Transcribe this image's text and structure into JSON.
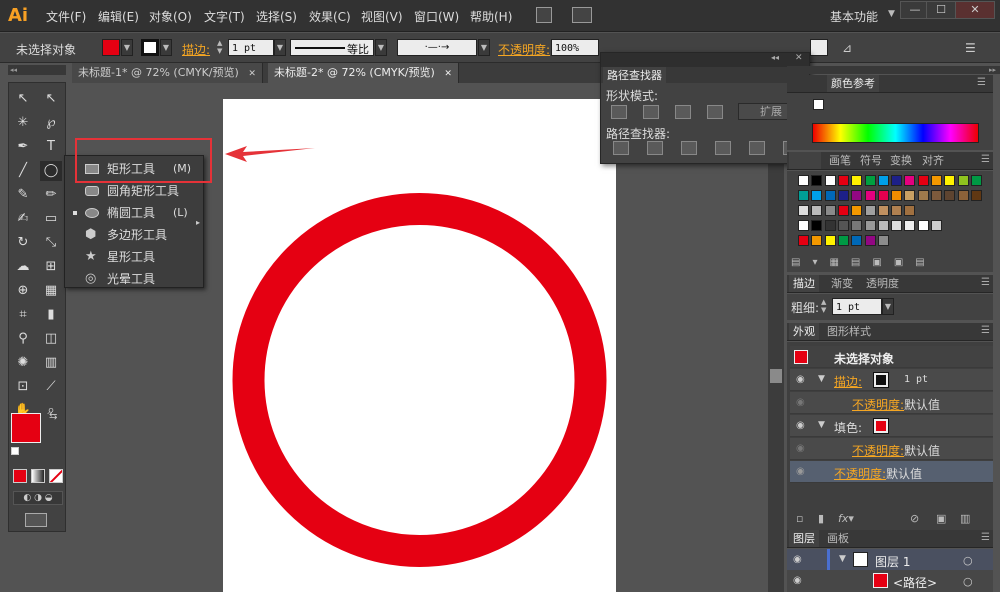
{
  "app": {
    "logo": "Ai"
  },
  "menubar": {
    "items": [
      "文件(F)",
      "编辑(E)",
      "对象(O)",
      "文字(T)",
      "选择(S)",
      "效果(C)",
      "视图(V)",
      "窗口(W)",
      "帮助(H)"
    ],
    "workspace": "基本功能",
    "window_buttons": [
      "—",
      "☐",
      "✕"
    ]
  },
  "control_bar": {
    "selection": "未选择对象",
    "stroke_label": "描边:",
    "stroke_value": "1 pt",
    "stroke_profile": "等比",
    "opacity_label": "不透明度:",
    "opacity_value": "100%"
  },
  "doc_tabs": [
    {
      "label": "未标题-1* @ 72% (CMYK/预览)",
      "close": "✕"
    },
    {
      "label": "未标题-2* @ 72% (CMYK/预览)",
      "close": "✕"
    }
  ],
  "tool_flyout": {
    "items": [
      {
        "label": "矩形工具",
        "shortcut": "(M)",
        "icon": "rectangle-icon"
      },
      {
        "label": "圆角矩形工具",
        "shortcut": "",
        "icon": "rounded-rectangle-icon"
      },
      {
        "label": "椭圆工具",
        "shortcut": "(L)",
        "icon": "ellipse-icon"
      },
      {
        "label": "多边形工具",
        "shortcut": "",
        "icon": "polygon-icon"
      },
      {
        "label": "星形工具",
        "shortcut": "",
        "icon": "star-icon"
      },
      {
        "label": "光晕工具",
        "shortcut": "",
        "icon": "flare-icon"
      }
    ]
  },
  "pathfinder": {
    "title": "路径查找器",
    "shape_modes_label": "形状模式:",
    "expand_label": "扩展",
    "pathfinders_label": "路径查找器:"
  },
  "right_panels": {
    "color_tabs": [
      "颜色参考"
    ],
    "swatch_tabs": [
      "画笔",
      "符号",
      "变换",
      "对齐"
    ],
    "stroke_tabs": [
      "描边",
      "渐变",
      "透明度"
    ],
    "stroke_weight_label": "粗细:",
    "stroke_weight_value": "1 pt",
    "appearance_tabs": [
      "外观",
      "图形样式"
    ],
    "appearance": {
      "header": "未选择对象",
      "stroke_label": "描边:",
      "stroke_value": "1 pt",
      "opacity_link": "不透明度:",
      "opacity_default": "默认值",
      "fill_label": "填色:",
      "fill_opacity_link": "不透明度:",
      "fill_opacity_default": "默认值",
      "bottom_opacity_link": "不透明度:",
      "bottom_opacity_default": "默认值"
    },
    "layer_tabs": [
      "图层",
      "画板"
    ],
    "layers": {
      "layer_name": "图层 1",
      "path_name": "<路径>"
    }
  },
  "colors": {
    "accent_red": "#e50012",
    "highlight": "#f5a623",
    "annotation_red": "#e53238"
  }
}
